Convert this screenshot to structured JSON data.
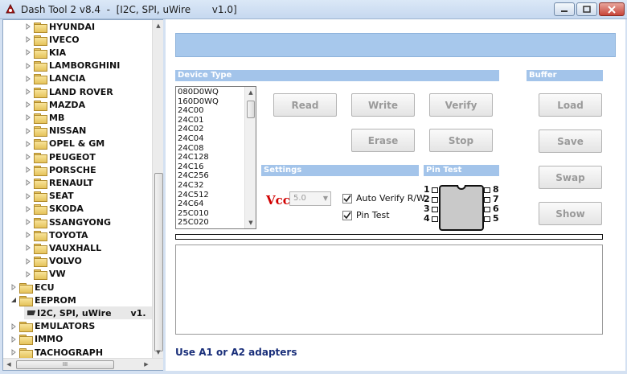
{
  "window": {
    "title": "Dash Tool 2 v8.4  -  [I2C, SPI, uWire       v1.0]",
    "minimize_icon": "minimize-icon",
    "maximize_icon": "maximize-icon",
    "close_icon": "close-icon"
  },
  "tree": {
    "brands": [
      "HYUNDAI",
      "IVECO",
      "KIA",
      "LAMBORGHINI",
      "LANCIA",
      "LAND ROVER",
      "MAZDA",
      "MB",
      "NISSAN",
      "OPEL & GM",
      "PEUGEOT",
      "PORSCHE",
      "RENAULT",
      "SEAT",
      "SKODA",
      "SSANGYONG",
      "TOYOTA",
      "VAUXHALL",
      "VOLVO",
      "VW"
    ],
    "top_items": {
      "ecu": "ECU",
      "eeprom": "EEPROM",
      "eeprom_child": "I2C, SPI, uWire",
      "eeprom_child_version": "v1.",
      "emulators": "EMULATORS",
      "immo": "IMMO",
      "tachograph": "TACHOGRAPH"
    },
    "hscroll_grip": "III"
  },
  "device_type": {
    "header": "Device Type",
    "items": [
      "080D0WQ",
      "160D0WQ",
      "24C00",
      "24C01",
      "24C02",
      "24C04",
      "24C08",
      "24C128",
      "24C16",
      "24C256",
      "24C32",
      "24C512",
      "24C64",
      "25C010",
      "25C020"
    ]
  },
  "buttons": {
    "read": "Read",
    "write": "Write",
    "verify": "Verify",
    "erase": "Erase",
    "stop": "Stop",
    "load": "Load",
    "save": "Save",
    "swap": "Swap",
    "show": "Show"
  },
  "buffer": {
    "header": "Buffer"
  },
  "settings": {
    "header": "Settings",
    "vcc_label": "Vcc",
    "vcc_value": "5.0",
    "auto_verify_label": "Auto Verify R/W",
    "auto_verify_checked": true,
    "pin_test_label": "Pin Test",
    "pin_test_checked": true
  },
  "pin_test": {
    "header": "Pin Test",
    "pins_left": [
      "1",
      "2",
      "3",
      "4"
    ],
    "pins_right": [
      "8",
      "7",
      "6",
      "5"
    ]
  },
  "footer": {
    "note": "Use A1 or A2 adapters"
  },
  "colors": {
    "accent": "#a3c4ea",
    "note_text": "#1a2f7a",
    "vcc_red": "#d10000"
  }
}
